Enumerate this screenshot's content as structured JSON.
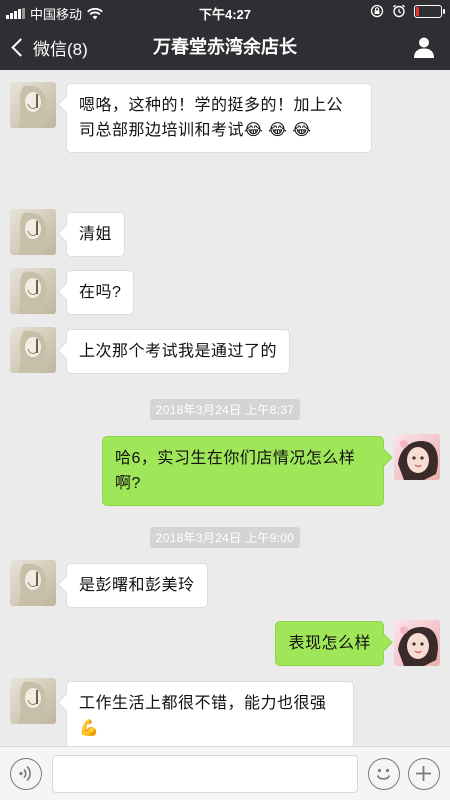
{
  "status_bar": {
    "carrier": "中国移动",
    "time": "下午4:27",
    "battery_level": 0.12
  },
  "nav": {
    "back_label": "微信(8)",
    "title": "万春堂赤湾余店长"
  },
  "messages": [
    {
      "type": "in",
      "lines": [
        "嗯咯，这种的！学的挺多的！加上公",
        "司总部那边培训和考试"
      ],
      "emoji_suffix": "😂 😂 😂"
    },
    {
      "type": "in",
      "lines": [
        "清姐"
      ]
    },
    {
      "type": "in",
      "lines": [
        "在吗?"
      ]
    },
    {
      "type": "in",
      "lines": [
        "上次那个考试我是通过了的"
      ]
    },
    {
      "type": "time",
      "text": "2018年3月24日 上午8:37"
    },
    {
      "type": "out",
      "lines": [
        "哈6，实习生在你们店情况怎么样",
        "啊?"
      ]
    },
    {
      "type": "time",
      "text": "2018年3月24日 上午9:00"
    },
    {
      "type": "in",
      "lines": [
        "是彭曙和彭美玲"
      ]
    },
    {
      "type": "out",
      "lines": [
        "表现怎么样"
      ]
    },
    {
      "type": "in",
      "lines": [
        "工作生活上都很不错，能力也很强"
      ],
      "emoji_suffix": "💪"
    }
  ],
  "colors": {
    "bar_bg": "#2e2e33",
    "chat_bg": "#ebebeb",
    "out_bubble": "#9fe658",
    "in_bubble": "#ffffff"
  },
  "icons": {
    "back": "chevron-left-icon",
    "profile": "person-icon",
    "voice": "voice-icon",
    "emoji": "smiley-icon",
    "plus": "plus-icon",
    "wifi": "wifi-icon",
    "signal": "signal-icon",
    "lock": "orientation-lock-icon",
    "alarm": "alarm-icon",
    "battery": "battery-icon"
  }
}
